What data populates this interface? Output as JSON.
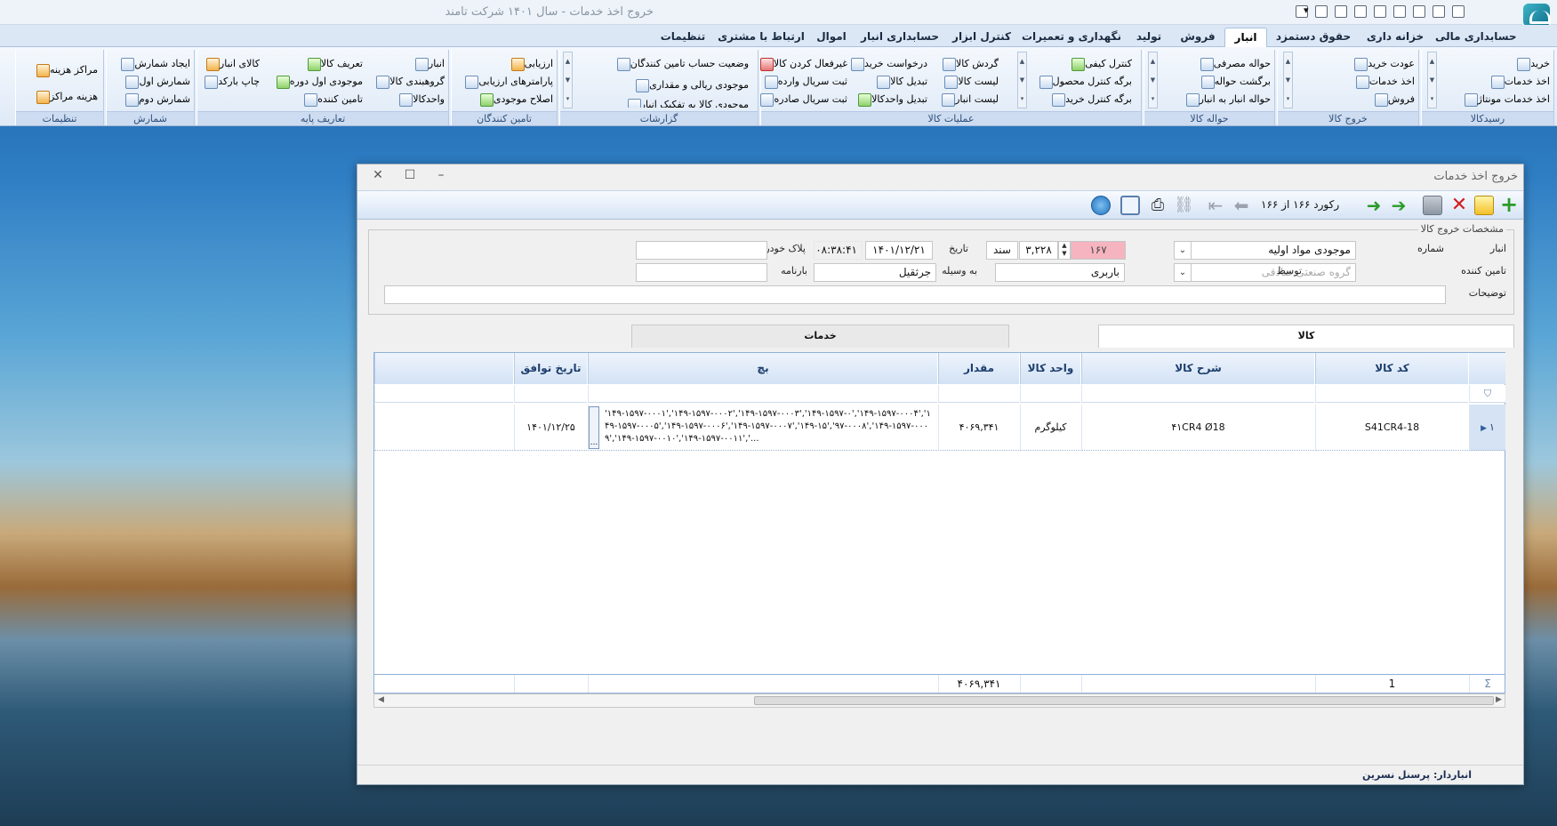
{
  "app": {
    "title": "خروج اخذ خدمات - سال ۱۴۰۱ شرکت تامند"
  },
  "tabs": [
    "حسابداری مالی",
    "خزانه داری",
    "حقوق دستمزد",
    "انبار",
    "فروش",
    "تولید",
    "نگهداری و تعمیرات",
    "کنترل ابزار",
    "حسابداری انبار",
    "اموال",
    "ارتباط با مشتری",
    "تنظیمات"
  ],
  "active_tab": "انبار",
  "ribbon": {
    "groups": [
      {
        "label": "رسیدکالا",
        "items": [
          "خرید",
          "اخذ خدمات",
          "اخذ خدمات مونتاژ"
        ]
      },
      {
        "label": "خروج کالا",
        "items": [
          "عودت خرید",
          "اخذ خدمات",
          "فروش"
        ]
      },
      {
        "label": "حواله کالا",
        "items": [
          "حواله مصرفی",
          "برگشت حواله",
          "حواله انبار به انبار"
        ]
      },
      {
        "label": "عملیات کالا",
        "items": [
          "کنترل کیفی",
          "برگه کنترل محصول",
          "برگه کنترل خرید",
          "گردش کالا",
          "لیست کالا",
          "لیست انبار",
          "درخواست خرید",
          "تبدیل کالا",
          "تبدیل واحدکالا",
          "غیرفعال کردن کالا",
          "ثبت سریال وارده",
          "ثبت سریال صادره"
        ]
      },
      {
        "label": "گزارشات",
        "items": [
          "وضعیت حساب تامین کنندگان",
          "موجودی ریالی و مقداری",
          "موجودی کالا به تفکیک انبار"
        ]
      },
      {
        "label": "تامین کنندگان",
        "items": [
          "ارزیابی",
          "پارامترهای ارزیابی",
          "اصلاح موجودی"
        ]
      },
      {
        "label": "تعاریف پایه",
        "items": [
          "انبار",
          "گروهبندی کالا",
          "واحدکالا",
          "تعریف کالا",
          "موجودی اول دوره",
          "تامین کننده",
          "کالای انبار",
          "چاپ بارکد"
        ]
      },
      {
        "label": "شمارش",
        "items": [
          "ایجاد شمارش",
          "شمارش اول",
          "شمارش دوم"
        ]
      },
      {
        "label": "تنظیمات",
        "items": [
          "مراکز هزینه",
          "هزینه مراکز"
        ]
      }
    ]
  },
  "dialog": {
    "title": "خروج اخذ خدمات",
    "record_text": "رکورد ۱۶۶ از ۱۶۶",
    "legend": "مشخصات خروج کالا",
    "fields": {
      "anbar_label": "انبار",
      "anbar_value": "موجودی مواد اولیه",
      "shomare_label": "شماره",
      "shomare_value": "۱۶۷",
      "sanad_value": "۳,۲۲۸",
      "sanad_label": "سند",
      "tarikh_label": "تاریخ",
      "tarikh_value": "۱۴۰۱/۱۲/۲۱",
      "time_value": "۰۸:۳۸:۴۱",
      "pelak_label": "پلاک خودرو",
      "pelak_value": "",
      "tamin_label": "تامین کننده",
      "tamin_value": "گروه صنعتی صادقی",
      "tavasot_label": "توسط",
      "tavasot_value": "باربری",
      "vasile_label": "به وسیله",
      "vasile_value": "جرثقیل",
      "barname_label": "بارنامه",
      "barname_value": "",
      "tozihat_label": "توضیحات",
      "tozihat_value": ""
    },
    "inner_tabs": [
      "کالا",
      "خدمات"
    ],
    "grid": {
      "columns": [
        "کد کالا",
        "شرح کالا",
        "واحد کالا",
        "مقدار",
        "بچ",
        "تاریخ توافق"
      ],
      "rows": [
        {
          "row_no": "۱",
          "code": "S41CR4-18",
          "desc": "۴۱CR4 Ø18",
          "unit": "کیلوگرم",
          "qty": "۴۰۶۹,۳۴۱",
          "batch": "'۱۴۹-۱۵۹۷-۰۰۰۱','۱۴۹-۱۵۹۷-۰۰۰۲','۱۴۹-۱۵۹۷-۰۰۰۳','۱۴۹-۱۵۹۷-۰','۱۴۹-۱۵۹۷-۰۰۰۴','۱۴۹-۱۵۹۷-۰۰۰۵','۱۴۹-۱۵۹۷-۰۰۰۶','۱۴۹-۱۵۹۷-۰۰۰۷','۱۴۹-۱۵','۹۷-۰۰۰۸','۱۴۹-۱۵۹۷-۰۰۰۹','۱۴۹-۱۵۹۷-۰۰۱۰','۱۴۹-۱۵۹۷-۰۰۱۱','...",
          "date": "۱۴۰۱/۱۲/۲۵",
          "ellipsis": "..."
        }
      ],
      "footer": {
        "count": "1",
        "qty_sum": "۴۰۶۹,۳۴۱"
      }
    },
    "status": "انباردار: پرسنل نسرین"
  }
}
